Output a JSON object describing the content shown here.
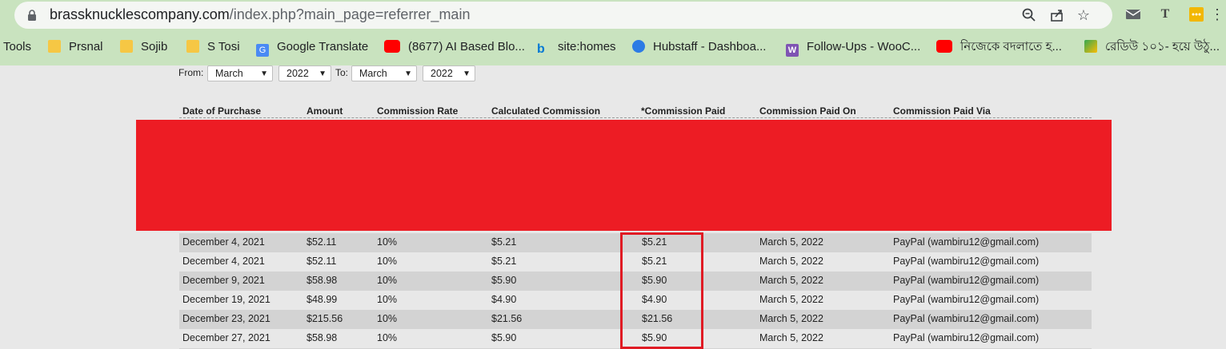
{
  "browser": {
    "url_host": "brassknucklescompany.com",
    "url_path": "/index.php?main_page=referrer_main",
    "bookmarks": [
      {
        "label": "Tools",
        "icon": "none"
      },
      {
        "label": "Prsnal",
        "icon": "folder-icon"
      },
      {
        "label": "Sojib",
        "icon": "folder-icon"
      },
      {
        "label": "S Tosi",
        "icon": "folder-icon"
      },
      {
        "label": "Google Translate",
        "icon": "google-translate-icon"
      },
      {
        "label": "(8677) AI Based Blo...",
        "icon": "youtube-icon"
      },
      {
        "label": "site:homes",
        "icon": "bing-icon"
      },
      {
        "label": "Hubstaff - Dashboa...",
        "icon": "hubstaff-icon"
      },
      {
        "label": "Follow-Ups - WooC...",
        "icon": "woocommerce-icon"
      },
      {
        "label": "নিজেকে বদলাতে হ...",
        "icon": "youtube-icon"
      },
      {
        "label": "রেডিউ ১০১- হয়ে উঠু...",
        "icon": "bookmark-icon"
      }
    ]
  },
  "filters": {
    "from_label": "From:",
    "from_month": "March",
    "from_year": "2022",
    "to_label": "To:",
    "to_month": "March",
    "to_year": "2022"
  },
  "table": {
    "headers": [
      "Date of Purchase",
      "Amount",
      "Commission Rate",
      "Calculated Commission",
      "*Commission Paid",
      "Commission Paid On",
      "Commission Paid Via"
    ],
    "rows": [
      [
        "December 4, 2021",
        "$52.11",
        "10%",
        "$5.21",
        "$5.21",
        "March 5, 2022",
        "PayPal (wambiru12@gmail.com)"
      ],
      [
        "December 4, 2021",
        "$52.11",
        "10%",
        "$5.21",
        "$5.21",
        "March 5, 2022",
        "PayPal (wambiru12@gmail.com)"
      ],
      [
        "December 9, 2021",
        "$58.98",
        "10%",
        "$5.90",
        "$5.90",
        "March 5, 2022",
        "PayPal (wambiru12@gmail.com)"
      ],
      [
        "December 19, 2021",
        "$48.99",
        "10%",
        "$4.90",
        "$4.90",
        "March 5, 2022",
        "PayPal (wambiru12@gmail.com)"
      ],
      [
        "December 23, 2021",
        "$215.56",
        "10%",
        "$21.56",
        "$21.56",
        "March 5, 2022",
        "PayPal (wambiru12@gmail.com)"
      ],
      [
        "December 27, 2021",
        "$58.98",
        "10%",
        "$5.90",
        "$5.90",
        "March 5, 2022",
        "PayPal (wambiru12@gmail.com)"
      ]
    ]
  },
  "colors": {
    "chrome_bg": "#c9e3bf",
    "redaction": "#ed1c24",
    "highlight_border": "#e01b24"
  }
}
